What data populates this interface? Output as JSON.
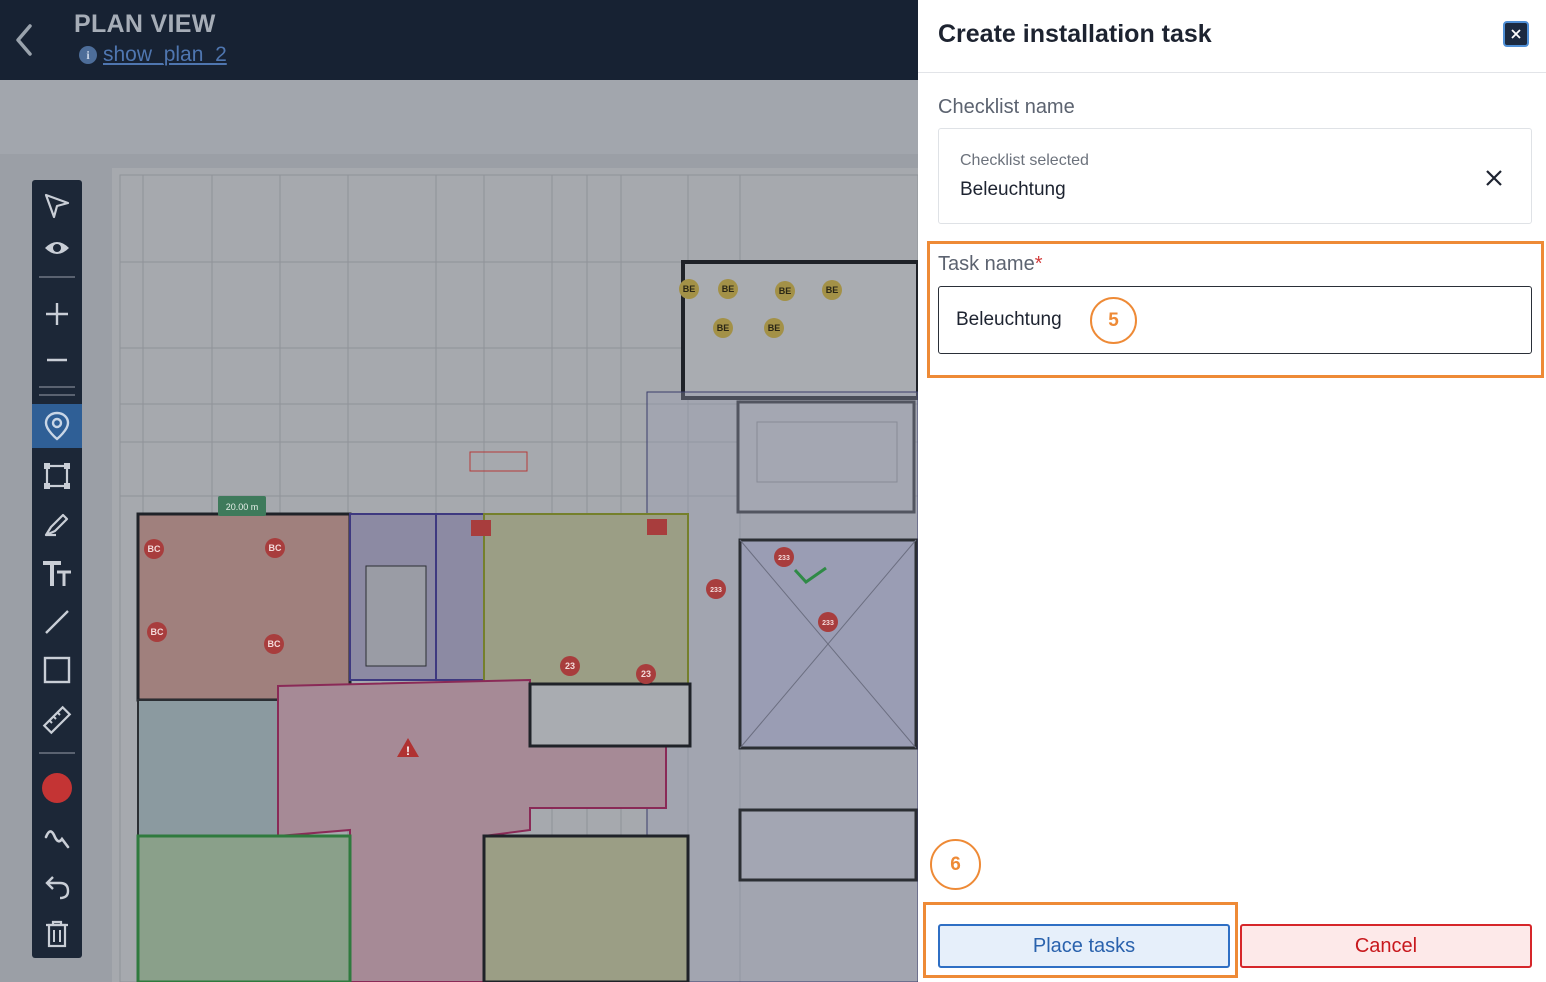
{
  "header": {
    "title": "PLAN VIEW",
    "plan_link": "show_plan_2"
  },
  "toolbar": {
    "tools": [
      "select-tool",
      "visibility-tool",
      "zoom-in",
      "zoom-out",
      "pin-tool",
      "area-tool",
      "pen-tool",
      "text-tool",
      "line-tool",
      "rectangle-tool",
      "measure-tool",
      "color-picker",
      "freehand-tool",
      "undo",
      "delete"
    ],
    "active_tool": "pin-tool",
    "color": "#d32a2a"
  },
  "plan": {
    "measure_label": "20.00 m",
    "markers": [
      "BE",
      "BE",
      "BE",
      "BE",
      "BE",
      "BE",
      "BC",
      "BC",
      "BC",
      "BC",
      "23",
      "23",
      "233",
      "233",
      "233"
    ]
  },
  "panel": {
    "title": "Create installation task",
    "checklist_label": "Checklist name",
    "checklist_caption": "Checklist selected",
    "checklist_value": "Beleuchtung",
    "task_label": "Task name",
    "task_required": "*",
    "task_value": "Beleuchtung",
    "step_5": "5",
    "step_6": "6",
    "place_label": "Place tasks",
    "cancel_label": "Cancel"
  },
  "colors": {
    "accent": "#2f6fc4",
    "danger": "#d6262a",
    "highlight": "#ee8a36",
    "topbar": "#172233"
  }
}
